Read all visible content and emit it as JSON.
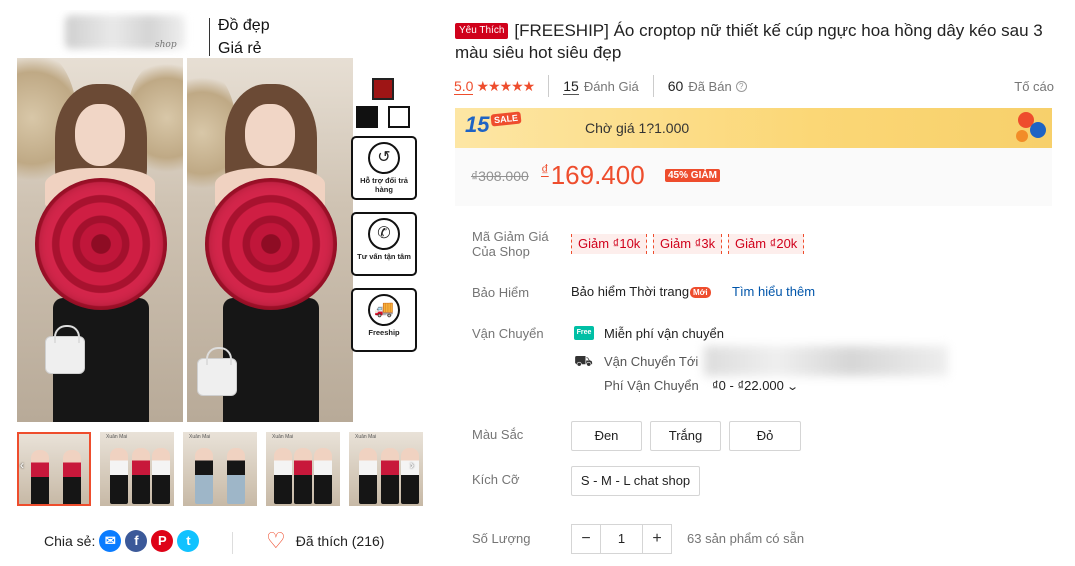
{
  "brand": {
    "line1": "Đồ đẹp",
    "line2": "Giá rẻ",
    "script": "shop"
  },
  "gallery": {
    "swatch_colors": [
      "#9e1515",
      "#111111",
      "#ffffff"
    ],
    "badges": [
      {
        "icon": "return-box-icon",
        "glyph": "↺",
        "text": "Hỗ trợ đổi trả hàng"
      },
      {
        "icon": "phone-icon",
        "glyph": "✆",
        "text": "Tư vấn tận tâm"
      },
      {
        "icon": "free-shipping-truck-icon",
        "glyph": "🚚",
        "text": "Freeship"
      }
    ],
    "thumb_label": "Xuân Mai"
  },
  "share": {
    "label": "Chia sẻ:",
    "icons": [
      "messenger-icon",
      "facebook-icon",
      "pinterest-icon",
      "twitter-icon"
    ]
  },
  "like": {
    "label": "Đã thích (216)"
  },
  "product": {
    "badge": "Yêu Thích",
    "title": "[FREESHIP] Áo croptop nữ thiết kế cúp ngực hoa hồng dây kéo sau 3 màu siêu hot siêu đẹp"
  },
  "rating": {
    "score": "5.0",
    "stars": "★★★★★",
    "reviews_count": "15",
    "reviews_label": "Đánh Giá",
    "sold_count": "60",
    "sold_label": "Đã Bán",
    "report": "Tố cáo"
  },
  "flash_sale": {
    "logo_number": "15",
    "logo_sale": "SALE",
    "text": "Chờ giá 1?1.000"
  },
  "price": {
    "old": "₫308.000",
    "currency": "₫",
    "new": "169.400",
    "discount": "45% GIẢM"
  },
  "details": {
    "voucher_label_1": "Mã Giảm Giá",
    "voucher_label_2": "Của Shop",
    "vouchers": [
      "Giảm ₫10k",
      "Giảm ₫3k",
      "Giảm ₫20k"
    ],
    "insurance_label": "Bảo Hiểm",
    "insurance_name": "Bảo hiểm Thời trang",
    "insurance_tag": "Mới",
    "learn_more": "Tìm hiểu thêm",
    "shipping_label": "Vận Chuyển",
    "free_ship_text": "Miễn phí vận chuyển",
    "free_ship_icon_text": "Free",
    "ship_to_label": "Vận Chuyển Tới",
    "ship_fee_label": "Phí Vận Chuyển",
    "ship_fee_value": "₫0 - ₫22.000",
    "color_label": "Màu Sắc",
    "colors": [
      "Đen",
      "Trắng",
      "Đỏ"
    ],
    "size_label": "Kích Cỡ",
    "sizes": [
      "S - M - L chat shop"
    ],
    "qty_label": "Số Lượng",
    "qty_minus": "−",
    "qty_value": "1",
    "qty_plus": "+",
    "stock": "63 sản phẩm có sẵn"
  }
}
